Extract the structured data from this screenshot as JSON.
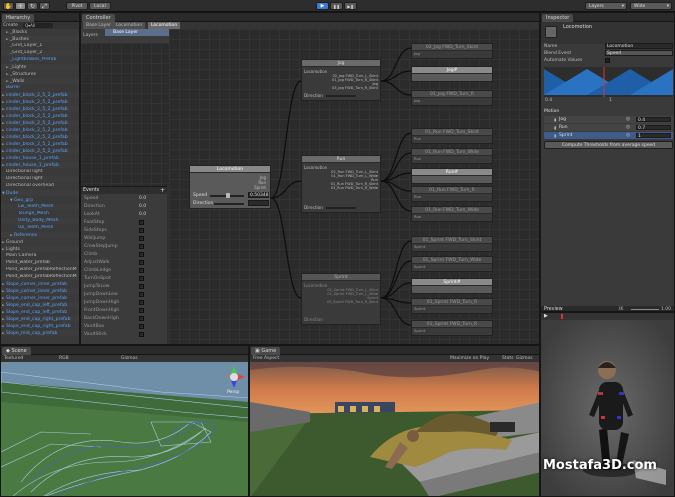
{
  "toolbar": {
    "play": "▶",
    "pause": "❚❚",
    "step": "▶❚",
    "pivot": "Pivot",
    "local": "Local",
    "layers": "Layers",
    "layout": "Wide"
  },
  "hierarchy": {
    "tab": "Hierarchy",
    "create": "Create",
    "search": "Q▾All",
    "items": [
      {
        "label": "_Blocks",
        "indent": 1,
        "arrow": "►",
        "blue": false
      },
      {
        "label": "_Bushes",
        "indent": 1,
        "arrow": "►",
        "blue": false
      },
      {
        "label": "_Grid_Layer_1",
        "indent": 1,
        "arrow": "",
        "blue": false
      },
      {
        "label": "_Grid_Layer_2",
        "indent": 1,
        "arrow": "",
        "blue": false
      },
      {
        "label": "_Lightbrobes_Prefab",
        "indent": 1,
        "arrow": "",
        "blue": true
      },
      {
        "label": "_Lights",
        "indent": 1,
        "arrow": "►",
        "blue": false
      },
      {
        "label": "_Structures",
        "indent": 1,
        "arrow": "►",
        "blue": false
      },
      {
        "label": "_Walls",
        "indent": 1,
        "arrow": "►",
        "blue": false
      },
      {
        "label": "Barrel",
        "indent": 0,
        "arrow": "",
        "blue": true
      },
      {
        "label": "cinder_block_2_5_2_prefab",
        "indent": 0,
        "arrow": "►",
        "blue": true
      },
      {
        "label": "cinder_block_2_5_2_prefab",
        "indent": 0,
        "arrow": "►",
        "blue": true
      },
      {
        "label": "cinder_block_2_5_2_prefab",
        "indent": 0,
        "arrow": "►",
        "blue": true
      },
      {
        "label": "cinder_block_2_5_2_prefab",
        "indent": 0,
        "arrow": "►",
        "blue": true
      },
      {
        "label": "cinder_block_2_5_2_prefab",
        "indent": 0,
        "arrow": "►",
        "blue": true
      },
      {
        "label": "cinder_block_2_5_2_prefab",
        "indent": 0,
        "arrow": "►",
        "blue": true
      },
      {
        "label": "cinder_block_2_5_2_prefab",
        "indent": 0,
        "arrow": "►",
        "blue": true
      },
      {
        "label": "cinder_block_2_5_2_prefab",
        "indent": 0,
        "arrow": "►",
        "blue": true
      },
      {
        "label": "cinder_block_2_5_2_prefab",
        "indent": 0,
        "arrow": "►",
        "blue": true
      },
      {
        "label": "cinder_house_1_prefab",
        "indent": 0,
        "arrow": "►",
        "blue": true
      },
      {
        "label": "cinder_house_1_prefab",
        "indent": 0,
        "arrow": "►",
        "blue": true
      },
      {
        "label": "Directional light",
        "indent": 0,
        "arrow": "",
        "blue": false
      },
      {
        "label": "Directional light",
        "indent": 0,
        "arrow": "",
        "blue": false
      },
      {
        "label": "Directional overhead",
        "indent": 0,
        "arrow": "",
        "blue": false
      },
      {
        "label": "Dude",
        "indent": 0,
        "arrow": "▼",
        "blue": true
      },
      {
        "label": "Geo_grp",
        "indent": 2,
        "arrow": "▼",
        "blue": true
      },
      {
        "label": "Lw_Teeth_Mesh",
        "indent": 3,
        "arrow": "",
        "blue": true
      },
      {
        "label": "Tounge_Mesh",
        "indent": 3,
        "arrow": "",
        "blue": true
      },
      {
        "label": "Unity_Body_Mesh",
        "indent": 3,
        "arrow": "",
        "blue": true
      },
      {
        "label": "Up_Teeth_Mesh",
        "indent": 3,
        "arrow": "",
        "blue": true
      },
      {
        "label": "Reference",
        "indent": 2,
        "arrow": "►",
        "blue": true
      },
      {
        "label": "Ground",
        "indent": 0,
        "arrow": "►",
        "blue": false
      },
      {
        "label": "Lights",
        "indent": 0,
        "arrow": "►",
        "blue": false
      },
      {
        "label": "Main Camera",
        "indent": 0,
        "arrow": "",
        "blue": false
      },
      {
        "label": "Pond_water_prefab",
        "indent": 0,
        "arrow": "",
        "blue": false
      },
      {
        "label": "Pond_water_prefabReflectionM",
        "indent": 0,
        "arrow": "",
        "blue": false
      },
      {
        "label": "Pond_water_prefabReflectionM",
        "indent": 0,
        "arrow": "",
        "blue": false
      },
      {
        "label": "Slope_corner_inner_prefab",
        "indent": 0,
        "arrow": "►",
        "blue": true
      },
      {
        "label": "Slope_corner_inner_prefab",
        "indent": 0,
        "arrow": "►",
        "blue": true
      },
      {
        "label": "Slope_corner_inner_prefab",
        "indent": 0,
        "arrow": "►",
        "blue": true
      },
      {
        "label": "Slope_end_cap_left_prefab",
        "indent": 0,
        "arrow": "►",
        "blue": true
      },
      {
        "label": "Slope_end_cap_left_prefab",
        "indent": 0,
        "arrow": "►",
        "blue": true
      },
      {
        "label": "Slope_end_cap_right_prefab",
        "indent": 0,
        "arrow": "►",
        "blue": true
      },
      {
        "label": "Slope_end_cap_right_prefab",
        "indent": 0,
        "arrow": "►",
        "blue": true
      },
      {
        "label": "Slope_mid_cap_prefab",
        "indent": 0,
        "arrow": "►",
        "blue": true
      }
    ]
  },
  "animator": {
    "tab": "Controller",
    "breadcrumb": [
      "Base Layer",
      "Locomotion",
      "Locomotion"
    ],
    "layers_label": "Layers",
    "base_layer": "Base Layer",
    "locomotion_node": {
      "title": "Locomotion",
      "rows": [
        "Jog",
        "Run",
        "Sprint"
      ],
      "speed_label": "Speed",
      "speed_value": "0.50348",
      "direction_label": "Direction"
    },
    "jog_node": {
      "title": "Jog",
      "sub": "Locomotion",
      "lines": [
        "02_Jog FWD_Turn_L_Skint",
        "01_Jog FWD_Turn_R_Skint",
        "Jog",
        "03_Jog FWD_Turn_R_Skint"
      ],
      "direction_label": "Direction"
    },
    "run_node": {
      "title": "Run",
      "sub": "Locomotion",
      "lines": [
        "02_Run FWD_Turn_L_Skint",
        "01_Run FWD_Turn_L_Wide",
        "Run",
        "01_Run FWD_Turn_R_Skint",
        "03_Run FWD_Turn_R_Wide"
      ],
      "direction_label": "Direction"
    },
    "sprint_node": {
      "title": "Sprint",
      "sub": "Locomotion",
      "lines": [
        "02_Sprint FWD_Turn_L_Skint",
        "01_Sprint FWD_Turn_L_Wide",
        "Sprint",
        "03_Sprint FWD_Turn_R_Skint"
      ],
      "direction_label": "Direction"
    },
    "right_nodes": [
      "02_Jog FWD_Turn_Skint",
      "Jog#",
      "01_Jog FWD_Turn_R",
      "01_Run FWD_Turn_Skint",
      "01_Run FWD_Turn_Wide",
      "Run#",
      "01_Run FWD_Turn_R",
      "01_Run FWD_Turn_Wide",
      "01_Sprint FWD_Turn_Skint",
      "01_Sprint FWD_Turn_Wide",
      "Sprint#",
      "01_Sprint FWD_Turn_R",
      "01_Sprint FWD_Turn_R"
    ],
    "right_subs": [
      "Jog",
      "",
      "Jog",
      "Run",
      "Run",
      "",
      "Run",
      "Run",
      "Sprint",
      "Sprint",
      "",
      "Sprint",
      "Sprint"
    ]
  },
  "events": {
    "title": "Events",
    "add": "+",
    "items": [
      {
        "label": "Speed",
        "value": "0.0"
      },
      {
        "label": "Direction",
        "value": "0.0"
      },
      {
        "label": "LookAt",
        "value": "0.0"
      },
      {
        "label": "FootStep",
        "value": ""
      },
      {
        "label": "SideSteps",
        "value": ""
      },
      {
        "label": "WallJump",
        "value": ""
      },
      {
        "label": "CrowStepJump",
        "value": ""
      },
      {
        "label": "Climb",
        "value": ""
      },
      {
        "label": "AdjustWalk",
        "value": ""
      },
      {
        "label": "ClimbLedge",
        "value": ""
      },
      {
        "label": "TurnOnSpot",
        "value": ""
      },
      {
        "label": "JumpToLow",
        "value": ""
      },
      {
        "label": "JumpDownLow",
        "value": ""
      },
      {
        "label": "JumpDownHigh",
        "value": ""
      },
      {
        "label": "FrontDownHigh",
        "value": ""
      },
      {
        "label": "BackDownHigh",
        "value": ""
      },
      {
        "label": "VaultBox",
        "value": ""
      },
      {
        "label": "VaultStick",
        "value": ""
      }
    ]
  },
  "inspector": {
    "tab": "Inspector",
    "title": "Locomotion",
    "name_label": "Name",
    "name_value": "Locomotion",
    "blend_event_label": "Blend Event",
    "blend_event_value": "Speed",
    "automate_label": "Automate Values",
    "graph_min": "0.4",
    "graph_max": "1",
    "motion_label": "Motion",
    "motions": [
      {
        "name": "Jog",
        "value": "0.4"
      },
      {
        "name": "Run",
        "value": "0.7"
      },
      {
        "name": "Sprint",
        "value": "1"
      }
    ],
    "compute_button": "Compute Thresholds from average speed",
    "preview_label": "Preview",
    "preview_ik": "IK",
    "preview_speed": "1.00"
  },
  "scene": {
    "tab": "Scene",
    "shading": "Textured",
    "render": "RGB",
    "gizmos": "Gizmos",
    "persp": "Persp"
  },
  "game": {
    "tab": "Game",
    "aspect": "Free Aspect",
    "maximize": "Maximize on Play",
    "stats": "Stats",
    "gizmos": "Gizmos"
  },
  "watermark": "Mostafa3D.com"
}
